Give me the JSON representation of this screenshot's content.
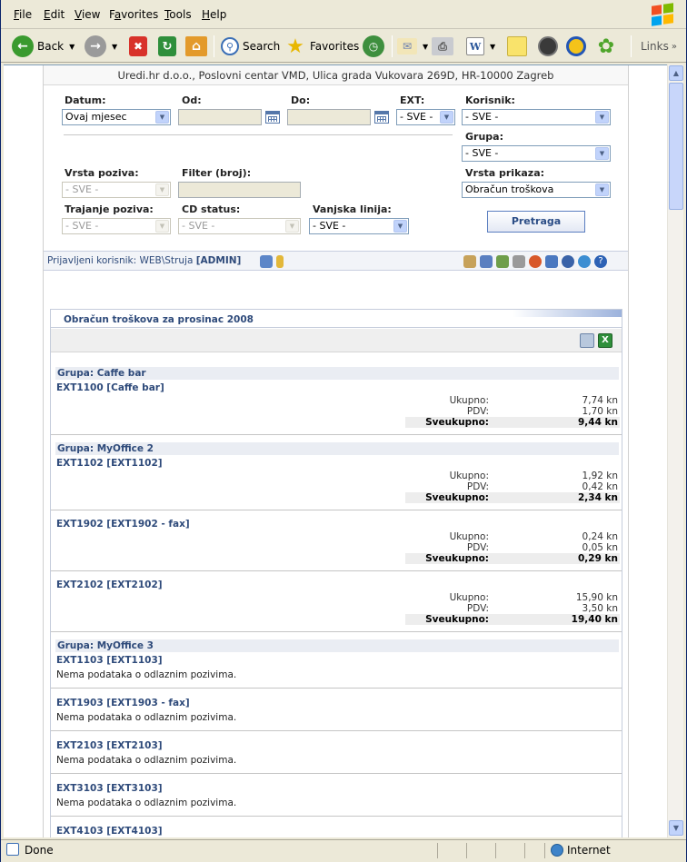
{
  "browser": {
    "menu": [
      "File",
      "Edit",
      "View",
      "Favorites",
      "Tools",
      "Help"
    ],
    "menu_accel": [
      "F",
      "E",
      "V",
      "a",
      "T",
      "H"
    ],
    "toolbar": {
      "back": "Back",
      "search": "Search",
      "favorites": "Favorites",
      "links": "Links"
    },
    "status": {
      "text": "Done",
      "zone": "Internet"
    }
  },
  "header": {
    "company": "Uredi.hr d.o.o., Poslovni centar VMD, Ulica grada Vukovara 269D, HR-10000 Zagreb"
  },
  "filters": {
    "datum_label": "Datum:",
    "datum_value": "Ovaj mjesec",
    "od_label": "Od:",
    "do_label": "Do:",
    "ext_label": "EXT:",
    "ext_value": "- SVE -",
    "korisnik_label": "Korisnik:",
    "korisnik_value": "- SVE -",
    "grupa_label": "Grupa:",
    "grupa_value": "- SVE -",
    "vrsta_poziva_label": "Vrsta poziva:",
    "vrsta_poziva_value": "- SVE -",
    "filter_label": "Filter (broj):",
    "vrsta_prikaza_label": "Vrsta prikaza:",
    "vrsta_prikaza_value": "Obračun troškova",
    "trajanje_label": "Trajanje poziva:",
    "trajanje_value": "- SVE -",
    "cd_label": "CD status:",
    "cd_value": "- SVE -",
    "vanjska_label": "Vanjska linija:",
    "vanjska_value": "- SVE -",
    "search_button": "Pretraga"
  },
  "userbar": {
    "prefix": "Prijavljeni korisnik: WEB\\Struja",
    "role": "[ADMIN]"
  },
  "report": {
    "title": "Obračun troškova za prosinac 2008",
    "labels": {
      "ukupno": "Ukupno:",
      "pdv": "PDV:",
      "sveukupno": "Sveukupno:"
    },
    "no_data": "Nema podataka o odlaznim pozivima.",
    "groups": [
      {
        "name": "Grupa: Caffe bar"
      },
      {
        "name": "Grupa: MyOffice 2"
      },
      {
        "name": "Grupa: MyOffice 3"
      }
    ],
    "entries": [
      {
        "ext": "EXT1100 [Caffe bar]",
        "ukupno": "7,74 kn",
        "pdv": "1,70 kn",
        "sveukupno": "9,44 kn"
      },
      {
        "ext": "EXT1102 [EXT1102]",
        "ukupno": "1,92 kn",
        "pdv": "0,42 kn",
        "sveukupno": "2,34 kn"
      },
      {
        "ext": "EXT1902 [EXT1902 - fax]",
        "ukupno": "0,24 kn",
        "pdv": "0,05 kn",
        "sveukupno": "0,29 kn"
      },
      {
        "ext": "EXT2102 [EXT2102]",
        "ukupno": "15,90 kn",
        "pdv": "3,50 kn",
        "sveukupno": "19,40 kn"
      },
      {
        "ext": "EXT1103 [EXT1103]"
      },
      {
        "ext": "EXT1903 [EXT1903 - fax]"
      },
      {
        "ext": "EXT2103 [EXT2103]"
      },
      {
        "ext": "EXT3103 [EXT3103]"
      },
      {
        "ext": "EXT4103 [EXT4103]"
      }
    ]
  }
}
